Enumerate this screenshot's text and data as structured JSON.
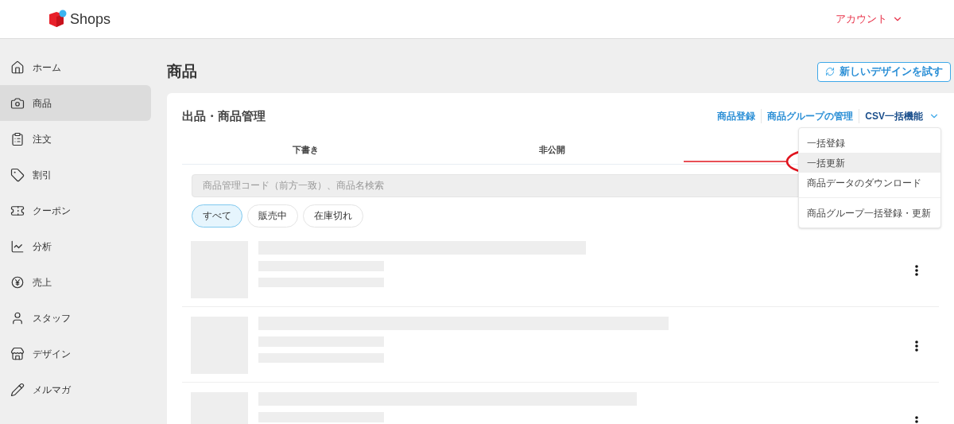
{
  "header": {
    "logo_text": "Shops",
    "account": "アカウント"
  },
  "sidebar": {
    "items": [
      {
        "label": "ホーム",
        "selected": false
      },
      {
        "label": "商品",
        "selected": true
      },
      {
        "label": "注文",
        "selected": false
      },
      {
        "label": "割引",
        "selected": false
      },
      {
        "label": "クーポン",
        "selected": false
      },
      {
        "label": "分析",
        "selected": false
      },
      {
        "label": "売上",
        "selected": false
      },
      {
        "label": "スタッフ",
        "selected": false
      },
      {
        "label": "デザイン",
        "selected": false
      },
      {
        "label": "メルマガ",
        "selected": false
      }
    ]
  },
  "page": {
    "title": "商品",
    "new_design_button": "新しいデザインを試す"
  },
  "card": {
    "title": "出品・商品管理",
    "links": [
      "商品登録",
      "商品グループの管理"
    ],
    "csv_menu": "CSV一括機能",
    "dropdown": [
      {
        "label": "一括登録",
        "selected": false,
        "divider_before": false
      },
      {
        "label": "一括更新",
        "selected": true,
        "divider_before": false
      },
      {
        "label": "商品データのダウンロード",
        "selected": false,
        "divider_before": false
      },
      {
        "label": "商品グループ一括登録・更新",
        "selected": false,
        "divider_before": true
      }
    ],
    "tabs": [
      {
        "label": "下書き"
      },
      {
        "label": "非公開"
      }
    ],
    "search": {
      "placeholder": "商品管理コード（前方一致）、商品名検索"
    },
    "filters": [
      {
        "label": "すべて",
        "selected": true
      },
      {
        "label": "販売中",
        "selected": false
      },
      {
        "label": "在庫切れ",
        "selected": false
      }
    ],
    "rows": [
      {
        "kind": "skeleton"
      },
      {
        "kind": "skeleton"
      },
      {
        "kind": "skeleton"
      }
    ]
  }
}
